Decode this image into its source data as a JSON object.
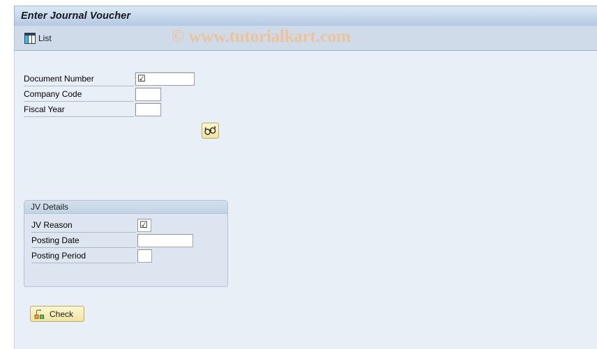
{
  "window": {
    "title": "Enter Journal Voucher"
  },
  "toolbar": {
    "buttons": [
      {
        "label": "List",
        "icon": "list-grid-icon"
      }
    ]
  },
  "watermark": {
    "text": "© www.tutorialkart.com",
    "color": "#f0c090"
  },
  "selection_fields": [
    {
      "label": "Document Number",
      "value": "",
      "placeholder": "",
      "has_checkbox_glyph": true,
      "checkbox_glyph": "☑"
    },
    {
      "label": "Company Code",
      "value": "",
      "placeholder": "",
      "has_checkbox_glyph": false
    },
    {
      "label": "Fiscal Year",
      "value": "",
      "placeholder": "",
      "has_checkbox_glyph": false
    }
  ],
  "multi_select_button": {
    "icon": "spectacles-icon",
    "tooltip": "Multiple selection"
  },
  "jv_details": {
    "title": "JV Details",
    "fields": [
      {
        "label": "JV Reason",
        "value": "",
        "placeholder": "",
        "has_checkbox_glyph": true,
        "checkbox_glyph": "☑"
      },
      {
        "label": "Posting Date",
        "value": "",
        "placeholder": "",
        "has_checkbox_glyph": false
      },
      {
        "label": "Posting Period",
        "value": "",
        "placeholder": "",
        "has_checkbox_glyph": false
      }
    ]
  },
  "check_button": {
    "label": "Check",
    "icon": "check-nodes-icon"
  },
  "colors": {
    "title_bar_top": "#dbe6f2",
    "title_bar_bottom": "#b3c9e2",
    "toolbar_bg": "#cfdbe8",
    "content_bg": "#e9eff7",
    "group_bg": "#dde6f0",
    "button_yellow": "#f7edb8",
    "watermark": "#f0c090"
  }
}
